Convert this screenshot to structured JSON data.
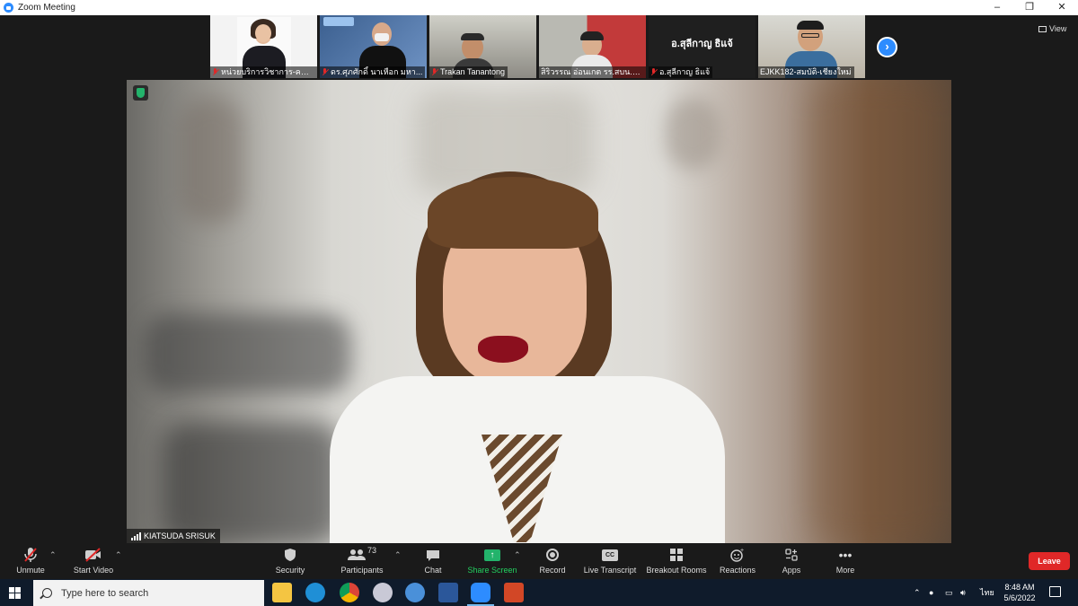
{
  "window": {
    "title": "Zoom Meeting",
    "controls": [
      "–",
      "❐",
      "✕"
    ]
  },
  "thumbnails": [
    {
      "name": "หน่วยบริการวิชาการ-คณ...",
      "muted": true
    },
    {
      "name": "ดร.ศุภศักดิ์ นาเหือก มหา...",
      "muted": true
    },
    {
      "name": "Trakan Tanantong",
      "muted": true
    },
    {
      "name": "สิริวรรณ อ่อนเกต รร.สบน.ชม.",
      "muted": false
    },
    {
      "name": "อ.สุลีกาญ ธิแจ้",
      "muted": true,
      "center_text": "อ.สุลีกาญ ธิแจ้"
    },
    {
      "name": "EJKK182-สมบัติ-เชียงใหม่",
      "muted": false
    }
  ],
  "view_button": {
    "label": "View",
    "icon": "grid-view-icon"
  },
  "next_page_icon": "chevron-right-icon",
  "speaker": {
    "name": "KIATSUDA SRISUK"
  },
  "toolbar": {
    "unmute": "Unmute",
    "start_video": "Start Video",
    "security": "Security",
    "participants": "Participants",
    "participants_count": "73",
    "chat": "Chat",
    "share_screen": "Share Screen",
    "record": "Record",
    "live_transcript": "Live Transcript",
    "cc": "CC",
    "breakout_rooms": "Breakout Rooms",
    "reactions": "Reactions",
    "apps": "Apps",
    "more": "More",
    "leave": "Leave"
  },
  "taskbar": {
    "search_placeholder": "Type here to search",
    "language": "ไทย",
    "time": "8:48 AM",
    "date": "5/6/2022"
  },
  "colors": {
    "zoom_blue": "#2d8cff",
    "leave_red": "#e02828",
    "share_green": "#23b36b",
    "taskbar": "#0f1b2b"
  }
}
